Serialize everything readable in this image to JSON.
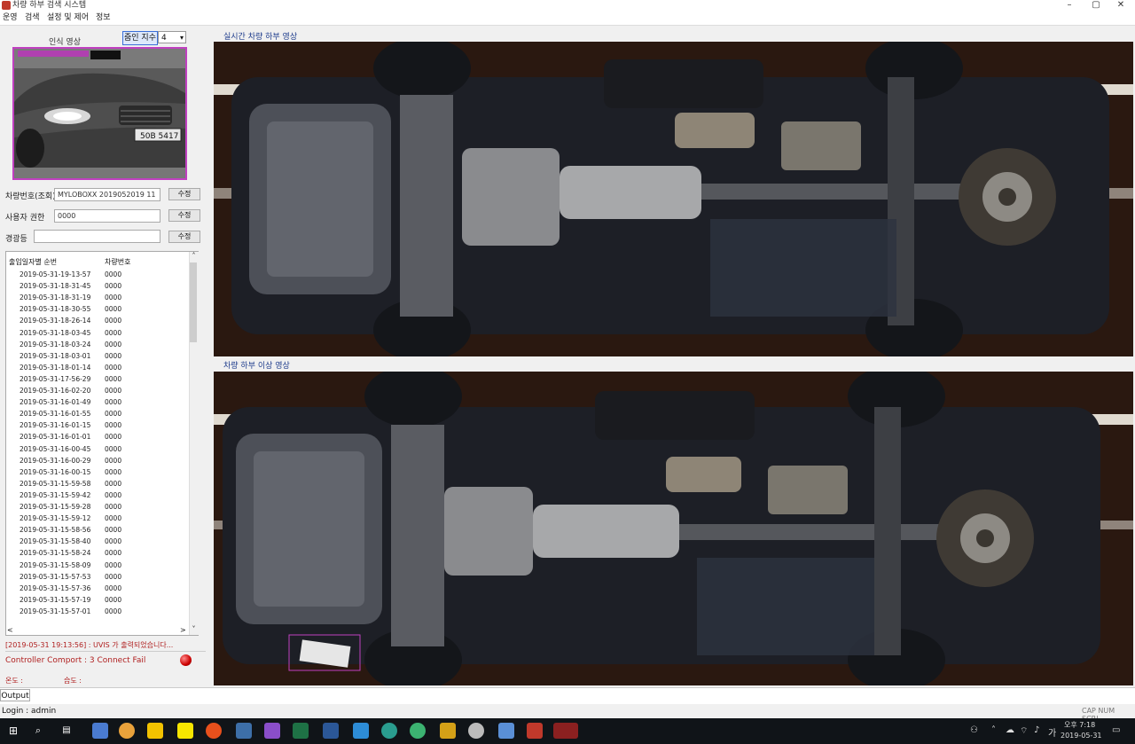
{
  "window": {
    "title": "차량 하부 검색 시스템",
    "minimize": "–",
    "maximize": "▢",
    "close": "✕"
  },
  "menu": [
    "운영",
    "검색",
    "설정 및 제어",
    "정보"
  ],
  "recognition": {
    "label": "인식 영상",
    "zoom_label": "줌인 지수",
    "zoom_value": "4"
  },
  "fields": [
    {
      "label": "차량번호(조회)",
      "value": "MYLOBOXX 2019052019 11",
      "button": "수정"
    },
    {
      "label": "사용자 권한",
      "value": "0000",
      "button": "수정"
    },
    {
      "label": "경광등",
      "value": "",
      "button": "수정"
    }
  ],
  "list": {
    "col_time": "출입일자별 순번",
    "col_num": "차량번호",
    "rows": [
      [
        "2019-05-31-19-13-57",
        "0000"
      ],
      [
        "2019-05-31-18-31-45",
        "0000"
      ],
      [
        "2019-05-31-18-31-19",
        "0000"
      ],
      [
        "2019-05-31-18-30-55",
        "0000"
      ],
      [
        "2019-05-31-18-26-14",
        "0000"
      ],
      [
        "2019-05-31-18-03-45",
        "0000"
      ],
      [
        "2019-05-31-18-03-24",
        "0000"
      ],
      [
        "2019-05-31-18-03-01",
        "0000"
      ],
      [
        "2019-05-31-18-01-14",
        "0000"
      ],
      [
        "2019-05-31-17-56-29",
        "0000"
      ],
      [
        "2019-05-31-16-02-20",
        "0000"
      ],
      [
        "2019-05-31-16-01-49",
        "0000"
      ],
      [
        "2019-05-31-16-01-55",
        "0000"
      ],
      [
        "2019-05-31-16-01-15",
        "0000"
      ],
      [
        "2019-05-31-16-01-01",
        "0000"
      ],
      [
        "2019-05-31-16-00-45",
        "0000"
      ],
      [
        "2019-05-31-16-00-29",
        "0000"
      ],
      [
        "2019-05-31-16-00-15",
        "0000"
      ],
      [
        "2019-05-31-15-59-58",
        "0000"
      ],
      [
        "2019-05-31-15-59-42",
        "0000"
      ],
      [
        "2019-05-31-15-59-28",
        "0000"
      ],
      [
        "2019-05-31-15-59-12",
        "0000"
      ],
      [
        "2019-05-31-15-58-56",
        "0000"
      ],
      [
        "2019-05-31-15-58-40",
        "0000"
      ],
      [
        "2019-05-31-15-58-24",
        "0000"
      ],
      [
        "2019-05-31-15-58-09",
        "0000"
      ],
      [
        "2019-05-31-15-57-53",
        "0000"
      ],
      [
        "2019-05-31-15-57-36",
        "0000"
      ],
      [
        "2019-05-31-15-57-19",
        "0000"
      ],
      [
        "2019-05-31-15-57-01",
        "0000"
      ]
    ]
  },
  "log_message": "[2019-05-31 19:13:56] : UVIS 가 출력되었습니다...",
  "controller_status": "Controller Comport : 3 Connect Fail",
  "temperature_label": "온도 :",
  "humidity_label": "습도 :",
  "panels": {
    "live_title": "실시간 차량 하부 영상",
    "ref_title": "차량 하부 이상 영상"
  },
  "output_tab": "Output",
  "login_status": "Login : admin",
  "keyboard_status": "CAP NUM SCRL",
  "clock": {
    "time": "오후 7:18",
    "date": "2019-05-31"
  },
  "colors": {
    "accent": "#1e3c8c",
    "alert": "#b02020",
    "taskbar": "#101418"
  }
}
